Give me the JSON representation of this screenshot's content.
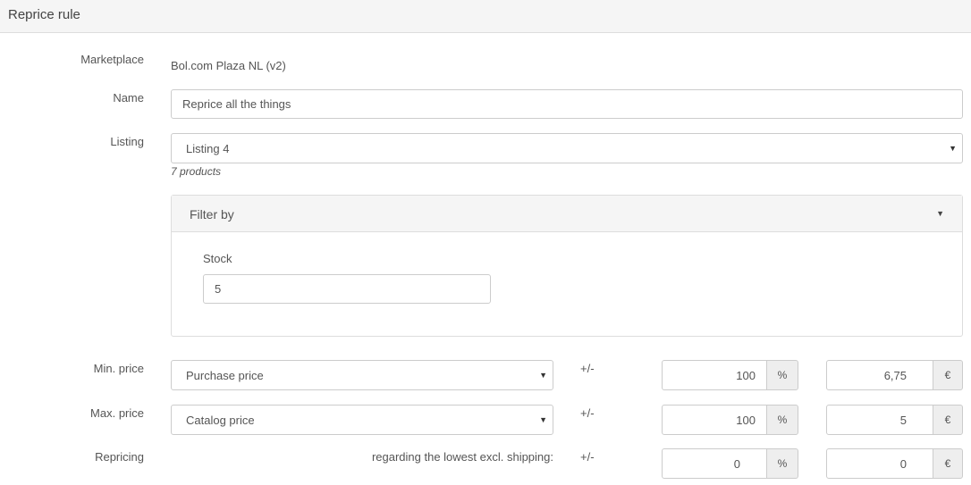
{
  "header": {
    "title": "Reprice rule"
  },
  "marketplace": {
    "label": "Marketplace",
    "value": "Bol.com Plaza NL (v2)"
  },
  "name": {
    "label": "Name",
    "value": "Reprice all the things"
  },
  "listing": {
    "label": "Listing",
    "selected": "Listing 4",
    "products_note": "7 products"
  },
  "filter": {
    "title": "Filter by",
    "stock_label": "Stock",
    "stock_value": "5"
  },
  "min_price": {
    "label": "Min. price",
    "base": "Purchase price",
    "plusminus": "+/-",
    "percent_value": "100",
    "percent_symbol": "%",
    "amount_value": "6,75",
    "currency": "€"
  },
  "max_price": {
    "label": "Max. price",
    "base": "Catalog price",
    "plusminus": "+/-",
    "percent_value": "100",
    "percent_symbol": "%",
    "amount_value": "5",
    "currency": "€"
  },
  "repricing": {
    "label": "Repricing",
    "regarding_text": "regarding the lowest excl. shipping:",
    "plusminus": "+/-",
    "percent_value": "0",
    "percent_symbol": "%",
    "amount_value": "0",
    "currency": "€"
  }
}
